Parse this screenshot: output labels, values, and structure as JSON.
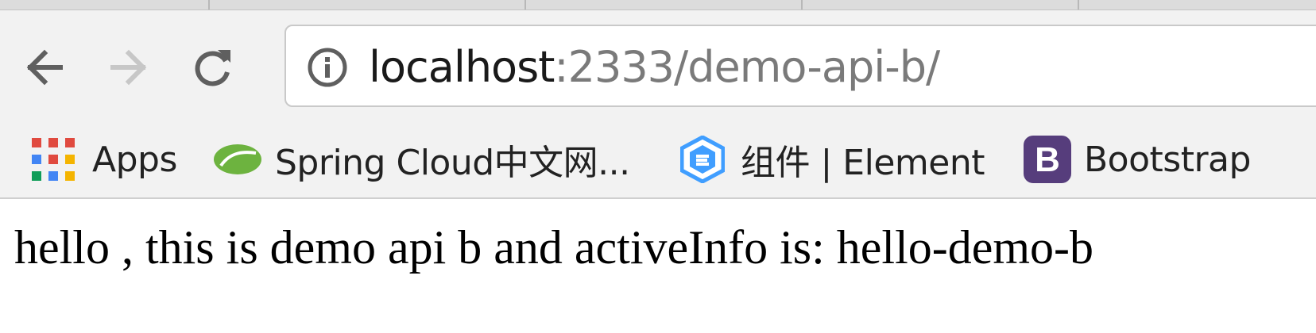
{
  "toolbar": {
    "back_icon": "arrow-left-icon",
    "forward_icon": "arrow-right-icon",
    "reload_icon": "reload-icon"
  },
  "address_bar": {
    "info_icon": "info-icon",
    "url_host": "localhost",
    "url_rest": ":2333/demo-api-b/"
  },
  "bookmarks": [
    {
      "label": "Apps",
      "icon": "apps-grid-icon"
    },
    {
      "label": "Spring Cloud中文网...",
      "icon": "spring-leaf-icon"
    },
    {
      "label": "组件 | Element",
      "icon": "element-hexagon-icon"
    },
    {
      "label": "Bootstrap",
      "icon": "bootstrap-b-icon"
    }
  ],
  "page": {
    "body_text": "hello , this is demo api b and activeInfo is: hello-demo-b"
  },
  "colors": {
    "toolbar_bg": "#f2f2f2",
    "url_host": "#1a1a1a",
    "url_rest": "#7a7a7a",
    "spring_green": "#6db33f",
    "element_blue": "#409eff",
    "bootstrap_purple": "#563d7c"
  }
}
